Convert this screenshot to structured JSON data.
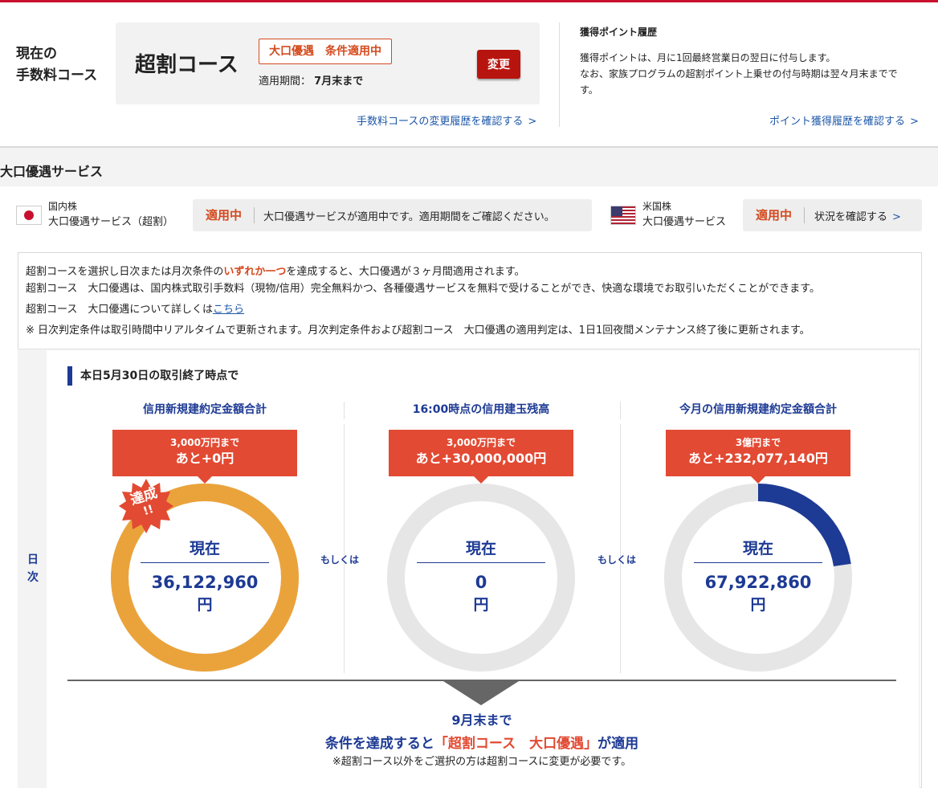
{
  "fee_course": {
    "label_line1": "現在の",
    "label_line2": "手数料コース",
    "name": "超割コース",
    "badge": "大口優遇　条件適用中",
    "period_label": "適用期間：",
    "period_value": "7月末まで",
    "change_button": "変更",
    "history_link": "手数料コースの変更履歴を確認する"
  },
  "points": {
    "title": "獲得ポイント履歴",
    "body_line1": "獲得ポイントは、月に1回最終営業日の翌日に付与します。",
    "body_line2": "なお、家族プログラムの超割ポイント上乗せの付与時期は翌々月末までで",
    "body_line3": "す。",
    "history_link": "ポイント獲得履歴を確認する"
  },
  "section_title": "大口優遇サービス",
  "domestic": {
    "label_line1": "国内株",
    "label_line2": "大口優遇サービス（超割）",
    "status": "適用中",
    "message": "大口優遇サービスが適用中です。適用期間をご確認ください。",
    "flag_icon": "japan-flag-icon"
  },
  "us": {
    "label_line1": "米国株",
    "label_line2": "大口優遇サービス",
    "status": "適用中",
    "link": "状況を確認する",
    "flag_icon": "us-flag-icon"
  },
  "info": {
    "line1_pre": "超割コースを選択し日次または月次条件の",
    "line1_hl": "いずれか一つ",
    "line1_post": "を達成すると、大口優遇が３ヶ月間適用されます。",
    "line2": "超割コース　大口優遇は、国内株式取引手数料（現物/信用）完全無料かつ、各種優遇サービスを無料で受けることができ、快適な環境でお取引いただくことができます。",
    "line3_pre": "超割コース　大口優遇について詳しくは",
    "line3_link": "こちら",
    "line4": "※  日次判定条件は取引時間中リアルタイムで更新されます。月次判定条件および超割コース　大口優遇の適用判定は、1日1回夜間メンテナンス終了後に更新されます。"
  },
  "daily": {
    "side_label_1": "日",
    "side_label_2": "次",
    "as_of": "本日5月30日の取引終了時点で",
    "or_label": "もしくは",
    "now_label": "現在",
    "unit": "円",
    "columns": [
      {
        "title": "信用新規建約定金額合計",
        "threshold": "3,000万円まで",
        "remaining": "あと+0円",
        "current": "36,122,960",
        "progress": 1.0,
        "ring_color": "#eaa33b",
        "achieved": true
      },
      {
        "title": "16:00時点の信用建玉残高",
        "threshold": "3,000万円まで",
        "remaining": "あと+30,000,000円",
        "current": "0",
        "progress": 0.0,
        "ring_color": "#1d3a94",
        "achieved": false
      },
      {
        "title": "今月の信用新規建約定金額合計",
        "threshold": "3億円まで",
        "remaining": "あと+232,077,140円",
        "current": "67,922,860",
        "progress": 0.2264,
        "ring_color": "#1d3a94",
        "achieved": false
      }
    ],
    "achieved_badge_line1": "達成",
    "achieved_badge_line2": "!!"
  },
  "footer": {
    "deadline": "9月末まで",
    "cond_pre": "条件を達成すると",
    "cond_hl": "「超割コース　大口優遇」",
    "cond_post": "が適用",
    "note": "※超割コース以外をご選択の方は超割コースに変更が必要です。"
  },
  "colors": {
    "accent_red": "#c8102e",
    "callout_red": "#e24a33",
    "navy": "#1d3a94",
    "ring_track": "#e6e6e6",
    "ring_achieved": "#eaa33b"
  }
}
